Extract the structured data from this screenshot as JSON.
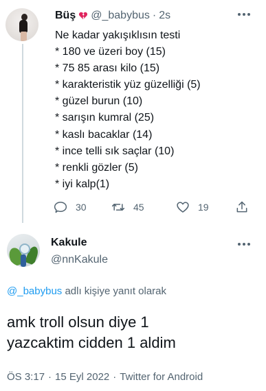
{
  "tweet1": {
    "display_name": "Büş",
    "handle": "@_babybus",
    "dot": "·",
    "time": "2s",
    "lines": [
      "Ne kadar yakışıklısın testi",
      "* 180 ve üzeri boy (15)",
      "* 75 85 arası kilo (15)",
      "* karakteristik yüz güzelliği (5)",
      "* güzel burun (10)",
      "* sarışın kumral (25)",
      "* kaslı bacaklar (14)",
      "* ince telli sık saçlar (10)",
      "* renkli gözler (5)",
      "* iyi kalp(1)"
    ],
    "replies": "30",
    "retweets": "45",
    "likes": "19"
  },
  "tweet2": {
    "display_name": "Kakule",
    "handle": "@nnKakule",
    "reply_mention": "@_babybus",
    "reply_suffix": " adlı kişiye yanıt olarak",
    "text_lines": [
      "amk troll olsun diye 1",
      "yazcaktim cidden 1 aldim"
    ],
    "time": "ÖS 3:17",
    "sep1": "·",
    "date": "15 Eyl 2022",
    "sep2": "·",
    "source": "Twitter for Android"
  },
  "icons": {
    "heart": "broken-heart-icon",
    "reply": "reply-icon",
    "retweet": "retweet-icon",
    "like": "like-icon",
    "share": "share-icon",
    "more": "more-icon"
  },
  "colors": {
    "text": "#0f1419",
    "secondary": "#536471",
    "link": "#1d9bf0",
    "heart": "#e0245e"
  }
}
